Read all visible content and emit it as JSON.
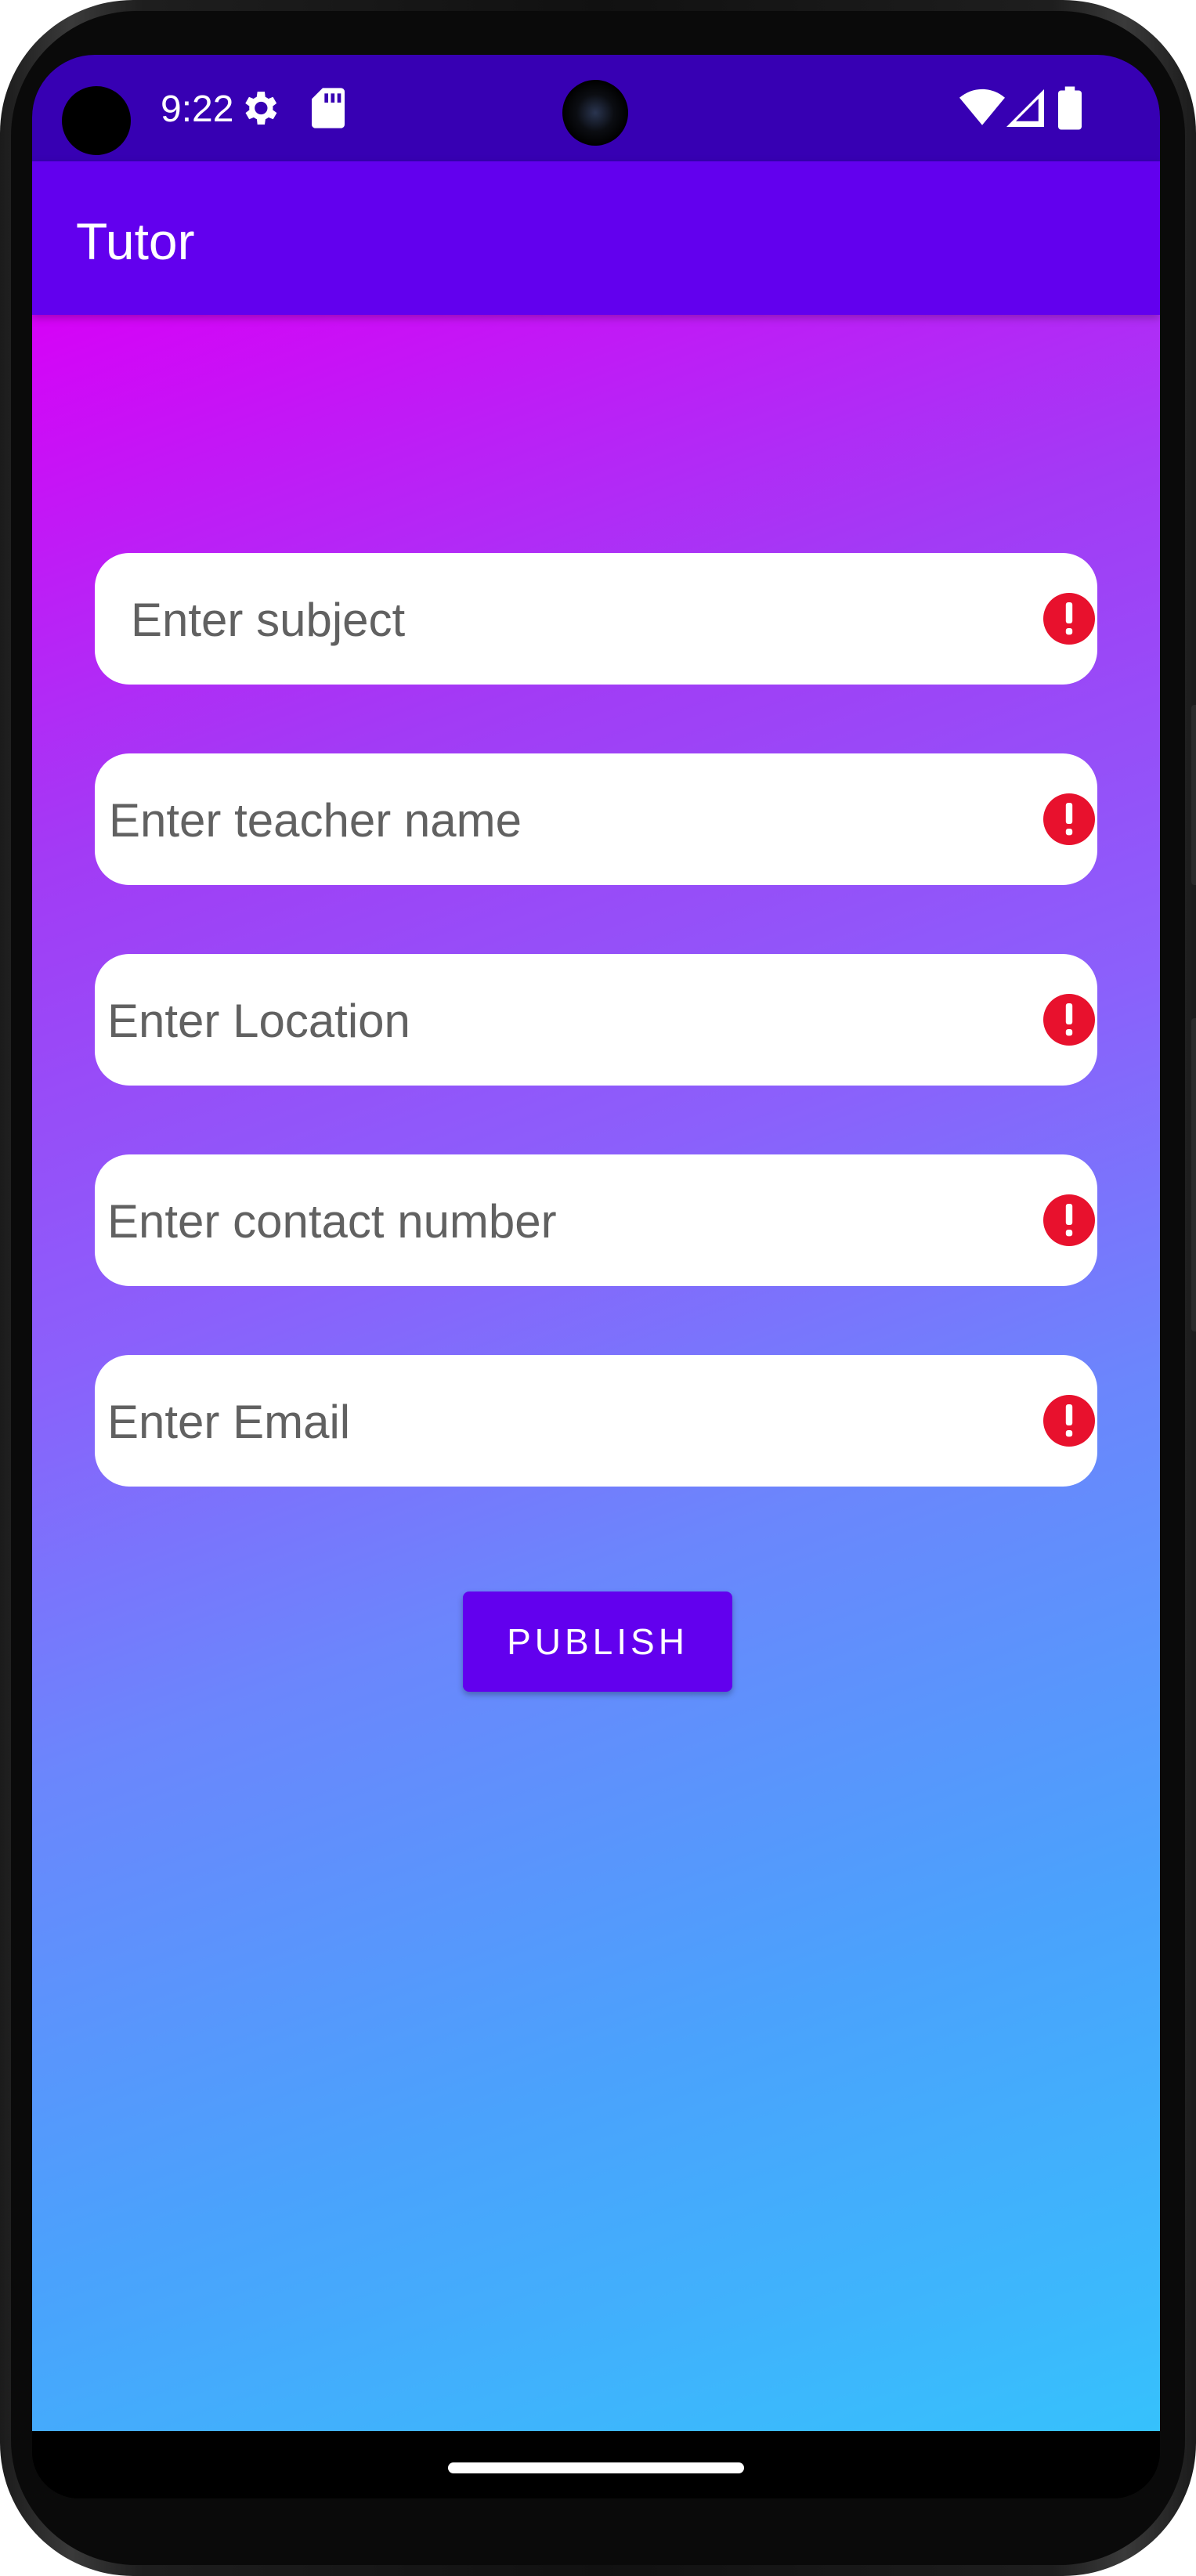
{
  "status_bar": {
    "time": "9:22",
    "icons": [
      "settings-gear-icon",
      "sd-card-icon",
      "wifi-icon",
      "cellular-signal-icon",
      "battery-icon"
    ]
  },
  "app_bar": {
    "title": "Tutor"
  },
  "form": {
    "fields": [
      {
        "name": "subject-input",
        "placeholder": "Enter subject",
        "error_icon": "error-icon"
      },
      {
        "name": "teacher-name-input",
        "placeholder": "Enter teacher name",
        "error_icon": "error-icon"
      },
      {
        "name": "location-input",
        "placeholder": "Enter Location",
        "error_icon": "error-icon"
      },
      {
        "name": "contact-number-input",
        "placeholder": "Enter contact number",
        "error_icon": "error-icon"
      },
      {
        "name": "email-input",
        "placeholder": "Enter Email",
        "error_icon": "error-icon"
      }
    ],
    "publish_label": "PUBLISH"
  },
  "colors": {
    "status_bar": "#3700b3",
    "app_bar": "#6200ee",
    "button": "#6200ee",
    "error": "#e8112d",
    "gradient_top": "#d602f7",
    "gradient_bottom": "#36c1fc"
  }
}
